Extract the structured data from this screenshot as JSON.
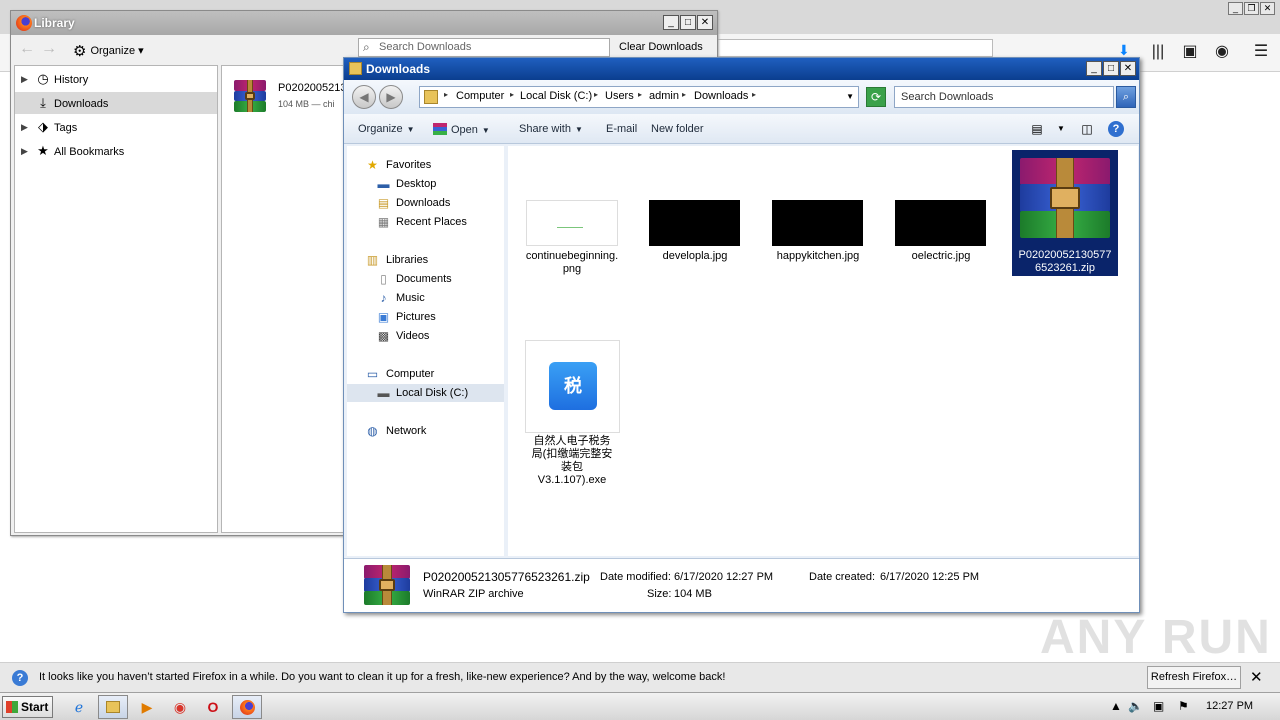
{
  "firefox": {
    "window_controls": [
      "_",
      "❐",
      "✕"
    ]
  },
  "library": {
    "title": "Library",
    "organize_label": "Organize",
    "search_placeholder": "Search Downloads",
    "clear_label": "Clear Downloads",
    "tree": [
      {
        "label": "History",
        "icon": "clock-icon"
      },
      {
        "label": "Downloads",
        "icon": "download-icon"
      },
      {
        "label": "Tags",
        "icon": "tag-icon"
      },
      {
        "label": "All Bookmarks",
        "icon": "star-icon"
      }
    ],
    "download_item": {
      "name": "P0202005213",
      "meta": "104 MB — chi"
    }
  },
  "explorer": {
    "title": "Downloads",
    "breadcrumbs": [
      "Computer",
      "Local Disk (C:)",
      "Users",
      "admin",
      "Downloads"
    ],
    "search_placeholder": "Search Downloads",
    "commands": [
      "Organize",
      "Open",
      "Share with",
      "E-mail",
      "New folder"
    ],
    "nav": {
      "favorites": "Favorites",
      "favorites_items": [
        "Desktop",
        "Downloads",
        "Recent Places"
      ],
      "libraries": "Libraries",
      "libraries_items": [
        "Documents",
        "Music",
        "Pictures",
        "Videos"
      ],
      "computer": "Computer",
      "computer_items": [
        "Local Disk (C:)"
      ],
      "network": "Network"
    },
    "files": [
      {
        "name": "continuebeginning.\npng"
      },
      {
        "name": "developla.jpg"
      },
      {
        "name": "happykitchen.jpg"
      },
      {
        "name": "oelectric.jpg"
      },
      {
        "name": "P02020052130577\n6523261.zip"
      },
      {
        "name": "自然人电子税务\n局(扣缴端完整安\n装包\nV3.1.107).exe",
        "icon_glyph": "税"
      }
    ],
    "details": {
      "name": "P020200521305776523261.zip",
      "type": "WinRAR ZIP archive",
      "modified_label": "Date modified:",
      "modified_value": "6/17/2020 12:27 PM",
      "created_label": "Date created:",
      "created_value": "6/17/2020 12:25 PM",
      "size_label": "Size:",
      "size_value": "104 MB"
    }
  },
  "notification": {
    "message": "It looks like you haven’t started Firefox in a while. Do you want to clean it up for a fresh, like-new experience? And by the way, welcome back!",
    "button": "Refresh Firefox…"
  },
  "taskbar": {
    "start": "Start",
    "clock": "12:27 PM"
  },
  "watermark": "ANY RUN"
}
